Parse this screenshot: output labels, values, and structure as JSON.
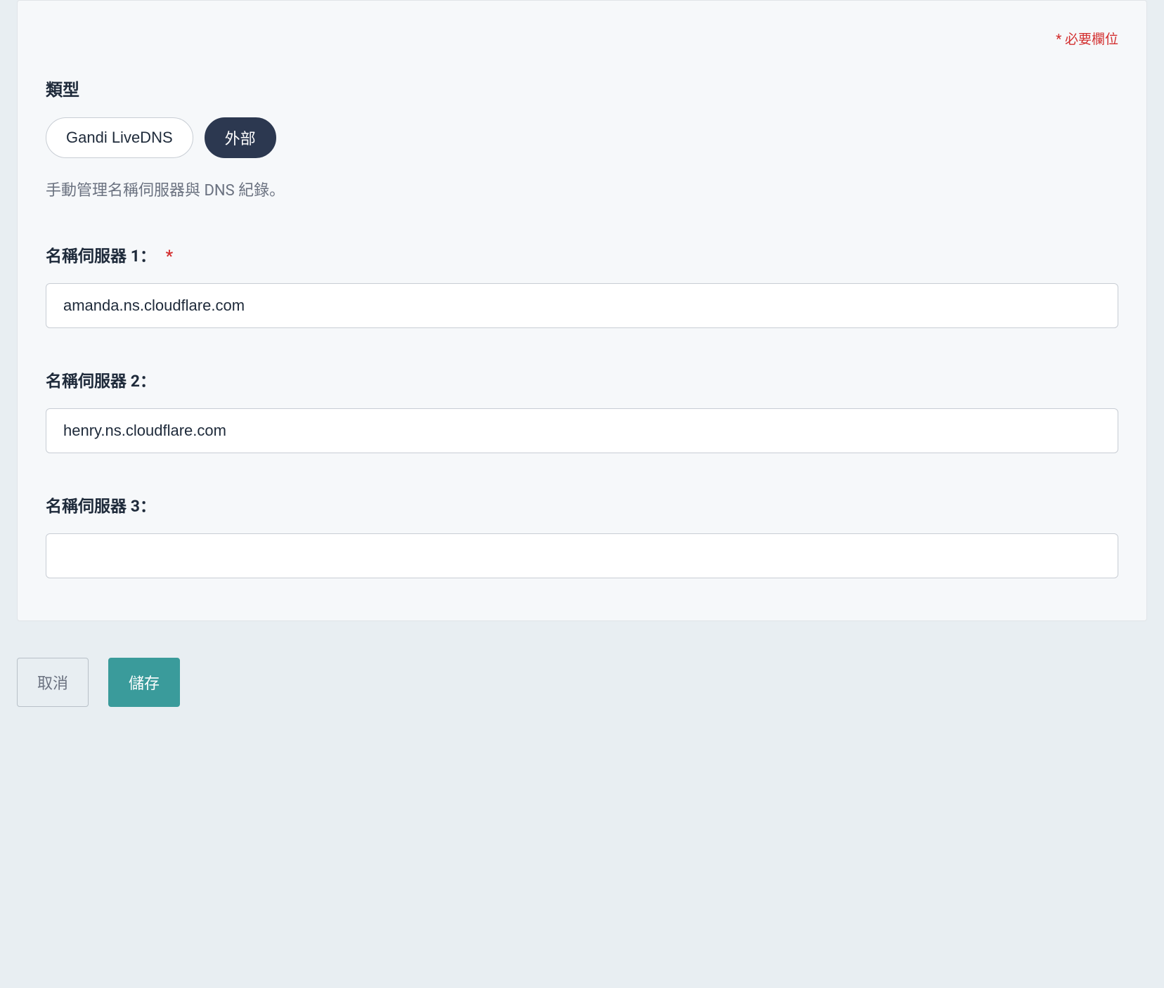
{
  "required_note": "* 必要欄位",
  "type": {
    "label": "類型",
    "options": {
      "live_dns": "Gandi LiveDNS",
      "external": "外部"
    },
    "helper_text": "手動管理名稱伺服器與 DNS 紀錄。"
  },
  "nameservers": {
    "ns1": {
      "label": "名稱伺服器 1：",
      "value": "amanda.ns.cloudflare.com",
      "required": "*"
    },
    "ns2": {
      "label": "名稱伺服器 2：",
      "value": "henry.ns.cloudflare.com"
    },
    "ns3": {
      "label": "名稱伺服器 3：",
      "value": ""
    }
  },
  "actions": {
    "cancel": "取消",
    "save": "儲存"
  }
}
